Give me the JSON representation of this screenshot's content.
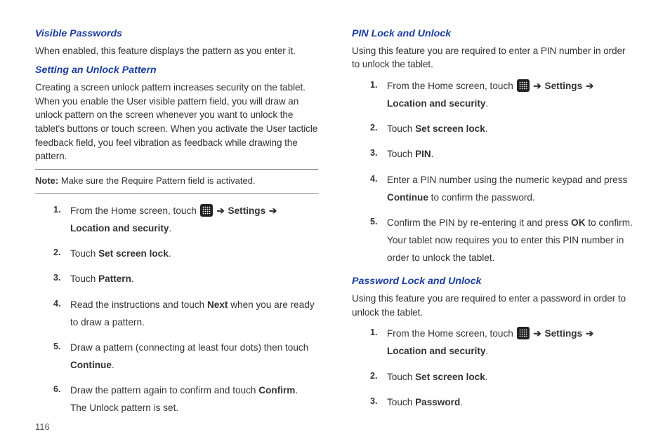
{
  "page_number": "116",
  "left": {
    "sec1_title": "Visible Passwords",
    "sec1_body": "When enabled, this feature displays the pattern as you enter it.",
    "sec2_title": "Setting an Unlock Pattern",
    "sec2_body": "Creating a screen unlock pattern increases security on the tablet. When you enable the User visible pattern field, you will draw an unlock pattern on the screen whenever you want to unlock the tablet's buttons or touch screen. When you activate the User tacticle feedback field, you feel vibration as feedback while drawing the pattern.",
    "note_label": "Note:",
    "note_text": " Make sure the Require Pattern field is activated.",
    "step1_a": "From the Home screen, touch ",
    "arrow": "➔",
    "kw_settings": "Settings",
    "kw_loc_sec": "Location and security",
    "step2_a": "Touch ",
    "kw_set_screen_lock": "Set screen lock",
    "step3_kw": "Pattern",
    "step4_a": "Read the instructions and touch ",
    "kw_next": "Next",
    "step4_b": " when you are ready to draw a pattern.",
    "step5_a": "Draw a pattern (connecting at least four dots) then touch ",
    "kw_continue": "Continue",
    "step6_a": "Draw the pattern again to confirm and touch ",
    "kw_confirm": "Confirm",
    "step6_b": "The Unlock pattern is set."
  },
  "right": {
    "sec1_title": "PIN Lock and Unlock",
    "sec1_body": "Using this feature you are required to enter a PIN number in order to unlock the tablet.",
    "step1_a": "From the Home screen, touch ",
    "arrow": "➔",
    "kw_settings": "Settings",
    "kw_loc_sec": "Location and security",
    "step2_a": "Touch ",
    "kw_set_screen_lock": "Set screen lock",
    "step3_kw": "PIN",
    "step4_a": "Enter a PIN number using the numeric keypad and press ",
    "kw_continue": "Continue",
    "step4_b": " to confirm the password.",
    "step5_a": "Confirm the PIN by re-entering it and press ",
    "kw_ok": "OK",
    "step5_b": " to confirm. Your tablet now requires you to enter this PIN number in order to unlock the tablet.",
    "sec2_title": "Password Lock and Unlock",
    "sec2_body": "Using this feature you are required to enter a password in order to unlock the tablet.",
    "pwd_step3_kw": "Password"
  }
}
